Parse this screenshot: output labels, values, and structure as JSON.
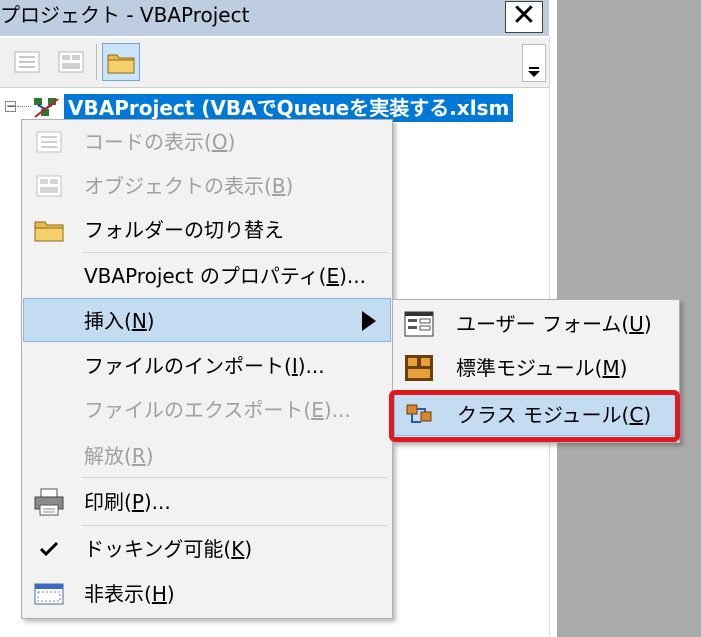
{
  "window": {
    "title": "プロジェクト - VBAProject",
    "close_symbol": "✕"
  },
  "tree": {
    "expander_symbol": "−",
    "project_label": "VBAProject (VBAでQueueを実装する.xlsm"
  },
  "context_menu": {
    "items": [
      {
        "pre": "コードの表示(",
        "key": "O",
        "post": ")",
        "icon": "code-view-icon",
        "enabled": false
      },
      {
        "pre": "オブジェクトの表示(",
        "key": "B",
        "post": ")",
        "icon": "object-view-icon",
        "enabled": false
      },
      {
        "pre": "フォルダーの切り替え",
        "key": "",
        "post": "",
        "icon": "folder-icon",
        "enabled": true
      },
      {
        "pre": "VBAProject のプロパティ(",
        "key": "E",
        "post": ")...",
        "icon": "",
        "enabled": true
      },
      {
        "pre": "挿入(",
        "key": "N",
        "post": ")",
        "icon": "",
        "enabled": true,
        "submenu": true,
        "highlighted": true
      },
      {
        "pre": "ファイルのインポート(",
        "key": "I",
        "post": ")...",
        "icon": "",
        "enabled": true
      },
      {
        "pre": "ファイルのエクスポート(",
        "key": "E",
        "post": ")...",
        "icon": "",
        "enabled": false
      },
      {
        "pre": "解放(",
        "key": "R",
        "post": ")",
        "icon": "",
        "enabled": false
      },
      {
        "pre": "印刷(",
        "key": "P",
        "post": ")...",
        "icon": "printer-icon",
        "enabled": true
      },
      {
        "pre": "ドッキング可能(",
        "key": "K",
        "post": ")",
        "icon": "checkmark-icon",
        "enabled": true,
        "checked": true
      },
      {
        "pre": "非表示(",
        "key": "H",
        "post": ")",
        "icon": "hide-window-icon",
        "enabled": true
      }
    ]
  },
  "submenu": {
    "items": [
      {
        "pre": "ユーザー フォーム(",
        "key": "U",
        "post": ")",
        "icon": "userform-icon"
      },
      {
        "pre": "標準モジュール(",
        "key": "M",
        "post": ")",
        "icon": "standard-module-icon"
      },
      {
        "pre": "クラス モジュール(",
        "key": "C",
        "post": ")",
        "icon": "class-module-icon",
        "highlighted": true
      }
    ]
  },
  "colors": {
    "selection": "#0078d7",
    "menu_hover": "#c4dcf2",
    "callout_red": "#e0191f"
  }
}
